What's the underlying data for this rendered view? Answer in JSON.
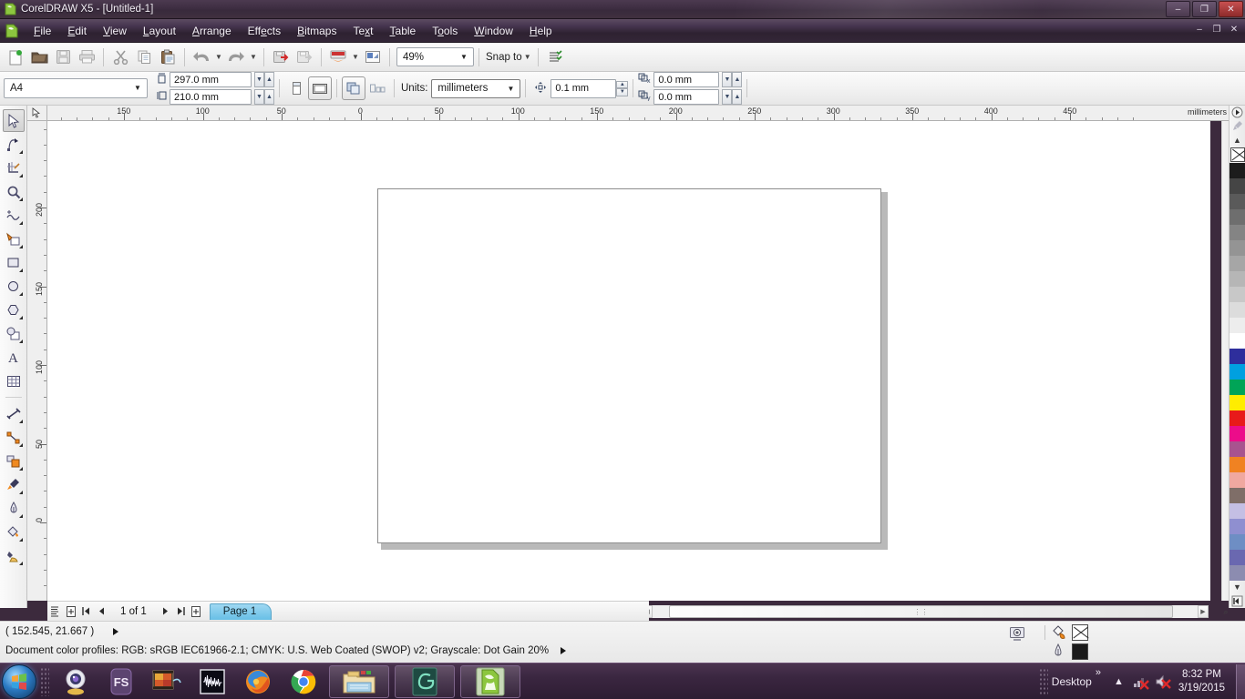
{
  "window": {
    "title": "CorelDRAW X5 - [Untitled-1]",
    "app_icon": "coreldraw-icon",
    "controls": {
      "minimize": "–",
      "maximize": "❐",
      "close": "✕"
    }
  },
  "menubar": {
    "doc_icon": "document-icon",
    "items": [
      {
        "label": "File",
        "pre": "",
        "key": "F",
        "post": "ile"
      },
      {
        "label": "Edit",
        "pre": "",
        "key": "E",
        "post": "dit"
      },
      {
        "label": "View",
        "pre": "",
        "key": "V",
        "post": "iew"
      },
      {
        "label": "Layout",
        "pre": "",
        "key": "L",
        "post": "ayout"
      },
      {
        "label": "Arrange",
        "pre": "",
        "key": "A",
        "post": "rrange"
      },
      {
        "label": "Effects",
        "pre": "Eff",
        "key": "e",
        "post": "cts"
      },
      {
        "label": "Bitmaps",
        "pre": "",
        "key": "B",
        "post": "itmaps"
      },
      {
        "label": "Text",
        "pre": "Te",
        "key": "x",
        "post": "t"
      },
      {
        "label": "Table",
        "pre": "",
        "key": "T",
        "post": "able"
      },
      {
        "label": "Tools",
        "pre": "T",
        "key": "o",
        "post": "ols"
      },
      {
        "label": "Window",
        "pre": "",
        "key": "W",
        "post": "indow"
      },
      {
        "label": "Help",
        "pre": "",
        "key": "H",
        "post": "elp"
      }
    ],
    "mdi_controls": {
      "minimize": "–",
      "restore": "❐",
      "close": "✕"
    }
  },
  "standard_toolbar": {
    "buttons": [
      {
        "name": "new-document-icon",
        "tip": "New"
      },
      {
        "name": "open-document-icon",
        "tip": "Open"
      },
      {
        "name": "save-icon",
        "tip": "Save"
      },
      {
        "name": "print-icon",
        "tip": "Print"
      },
      {
        "name": "cut-icon",
        "tip": "Cut"
      },
      {
        "name": "copy-icon",
        "tip": "Copy"
      },
      {
        "name": "paste-icon",
        "tip": "Paste"
      },
      {
        "name": "undo-icon",
        "tip": "Undo"
      },
      {
        "name": "redo-icon",
        "tip": "Redo"
      },
      {
        "name": "import-icon",
        "tip": "Import"
      },
      {
        "name": "export-icon",
        "tip": "Export"
      },
      {
        "name": "publish-pdf-icon",
        "tip": "Publish to PDF"
      },
      {
        "name": "application-launcher-icon",
        "tip": "Application Launcher"
      }
    ],
    "zoom_level": "49%",
    "snap_to_label": "Snap to",
    "options_icon": "options-icon"
  },
  "property_bar": {
    "page_preset": "A4",
    "page_width": "297.0 mm",
    "page_height": "210.0 mm",
    "orientation": {
      "portrait_icon": "portrait-icon",
      "landscape_icon": "landscape-icon",
      "selected": "landscape"
    },
    "all_pages_icon": "all-pages-icon",
    "current_page_icon": "current-page-icon",
    "units_label": "Units:",
    "units_value": "millimeters",
    "nudge_icon": "nudge-icon",
    "nudge_value": "0.1 mm",
    "duplicate_x_icon": "duplicate-offset-x-icon",
    "duplicate_x": "0.0 mm",
    "duplicate_y_icon": "duplicate-offset-y-icon",
    "duplicate_y": "0.0 mm"
  },
  "toolbox": {
    "tools": [
      {
        "name": "pick-tool",
        "glyph": "pick",
        "active": true,
        "flyout": false
      },
      {
        "name": "shape-tool",
        "glyph": "shape",
        "active": false,
        "flyout": true
      },
      {
        "name": "crop-tool",
        "glyph": "crop",
        "active": false,
        "flyout": true
      },
      {
        "name": "zoom-tool",
        "glyph": "zoom",
        "active": false,
        "flyout": true
      },
      {
        "name": "freehand-tool",
        "glyph": "freehand",
        "active": false,
        "flyout": true
      },
      {
        "name": "smart-fill-tool",
        "glyph": "smartfill",
        "active": false,
        "flyout": true
      },
      {
        "name": "rectangle-tool",
        "glyph": "rect",
        "active": false,
        "flyout": true
      },
      {
        "name": "ellipse-tool",
        "glyph": "ellipse",
        "active": false,
        "flyout": true
      },
      {
        "name": "polygon-tool",
        "glyph": "polygon",
        "active": false,
        "flyout": true
      },
      {
        "name": "basic-shapes-tool",
        "glyph": "shapes",
        "active": false,
        "flyout": true
      },
      {
        "name": "text-tool",
        "glyph": "text",
        "active": false,
        "flyout": false
      },
      {
        "name": "table-tool",
        "glyph": "table",
        "active": false,
        "flyout": false
      },
      {
        "name": "dimension-tool",
        "glyph": "dimension",
        "active": false,
        "flyout": true
      },
      {
        "name": "connector-tool",
        "glyph": "connector",
        "active": false,
        "flyout": true
      },
      {
        "name": "blend-tool",
        "glyph": "blend",
        "active": false,
        "flyout": true
      },
      {
        "name": "color-eyedropper-tool",
        "glyph": "eyedrop",
        "active": false,
        "flyout": true
      },
      {
        "name": "outline-tool",
        "glyph": "outline",
        "active": false,
        "flyout": true
      },
      {
        "name": "fill-tool",
        "glyph": "fill",
        "active": false,
        "flyout": true
      },
      {
        "name": "interactive-fill-tool",
        "glyph": "ifill",
        "active": false,
        "flyout": true
      }
    ]
  },
  "rulers": {
    "units_label": "millimeters",
    "vertical_units_label": "millimeters",
    "h_labels": [
      "150",
      "100",
      "50",
      "0",
      "50",
      "100",
      "150",
      "200",
      "250",
      "300",
      "350",
      "400",
      "450"
    ],
    "v_labels": [
      "200",
      "150",
      "100",
      "50",
      "0"
    ]
  },
  "page_navigator": {
    "page_counter": "1 of 1",
    "tab_label": "Page 1",
    "buttons": {
      "add_page_start": "add-page-before-icon",
      "first": "first-page-icon",
      "prev": "previous-page-icon",
      "next": "next-page-icon",
      "last": "last-page-icon",
      "add_page_end": "add-page-after-icon"
    }
  },
  "statusbar": {
    "coordinates": "( 152.545, 21.667 )",
    "color_profiles": "Document color profiles: RGB: sRGB IEC61966-2.1; CMYK: U.S. Web Coated (SWOP) v2; Grayscale: Dot Gain 20%",
    "snapshot_icon": "snapshot-icon",
    "fill_icon": "fill-swatch-icon",
    "fill_value_name": "none",
    "outline_icon": "outline-pen-icon",
    "outline_color": "#1a1a1a"
  },
  "palette": {
    "name": "default-cmyk-palette",
    "scroll_up_icon": "scroll-up-icon",
    "scroll_down_icon": "scroll-down-icon",
    "jump_icon": "palette-jump-icon",
    "eyedropper_icon": "palette-eyedropper-icon",
    "no_color_icon": "no-color-icon",
    "colors": [
      "#1c1c1c",
      "#454545",
      "#5a5a5a",
      "#6e6e6e",
      "#848484",
      "#949494",
      "#a6a6a6",
      "#b6b6b6",
      "#c8c8c8",
      "#dcdcdc",
      "#ededed",
      "#ffffff",
      "#2e2e9c",
      "#00a0e0",
      "#00a457",
      "#ffed00",
      "#e81a1a",
      "#ec0c8a",
      "#a8538f",
      "#f08222",
      "#f0a8a0",
      "#7f6e68",
      "#c4bfe4",
      "#8f8fd0",
      "#6e8ec4",
      "#6a68b0",
      "#8c8cb0"
    ]
  },
  "taskbar": {
    "start_label": "start-orb-icon",
    "apps": [
      {
        "name": "webcam-app-icon",
        "label": ""
      },
      {
        "name": "fs-app-icon",
        "label": "FS"
      },
      {
        "name": "video-editor-icon",
        "label": ""
      },
      {
        "name": "audio-editor-icon",
        "label": ""
      },
      {
        "name": "firefox-icon",
        "label": ""
      },
      {
        "name": "chrome-icon",
        "label": ""
      }
    ],
    "windows": [
      {
        "name": "file-explorer-window",
        "label": ""
      },
      {
        "name": "sogou-input-window",
        "label": ""
      },
      {
        "name": "coreldraw-window",
        "label": ""
      }
    ],
    "tray": {
      "desktop_label": "Desktop",
      "overflow_glyph": "»",
      "show_hidden_icon": "chevron-up-icon",
      "network_icon": "network-disconnected-icon",
      "volume_icon": "volume-muted-icon",
      "time": "8:32 PM",
      "date": "3/19/2015"
    }
  }
}
